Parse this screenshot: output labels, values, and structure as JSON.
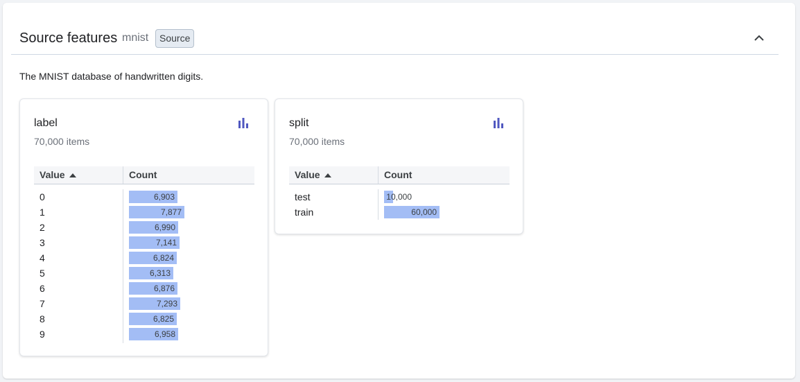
{
  "header": {
    "title": "Source features",
    "subtitle": "mnist",
    "badge": "Source",
    "collapse_icon": "chevron-up-icon"
  },
  "description": "The MNIST database of handwritten digits.",
  "accent_color": "#5058c0",
  "bar_color": "#a3bdf5",
  "cards": [
    {
      "title": "label",
      "subtitle": "70,000 items",
      "icon": "bar-chart-icon",
      "columns": [
        "Value",
        "Count"
      ],
      "sort_icon": "sort-ascending-icon",
      "rows": [
        {
          "value": "0",
          "count": 6903,
          "count_label": "6,903"
        },
        {
          "value": "1",
          "count": 7877,
          "count_label": "7,877"
        },
        {
          "value": "2",
          "count": 6990,
          "count_label": "6,990"
        },
        {
          "value": "3",
          "count": 7141,
          "count_label": "7,141"
        },
        {
          "value": "4",
          "count": 6824,
          "count_label": "6,824"
        },
        {
          "value": "5",
          "count": 6313,
          "count_label": "6,313"
        },
        {
          "value": "6",
          "count": 6876,
          "count_label": "6,876"
        },
        {
          "value": "7",
          "count": 7293,
          "count_label": "7,293"
        },
        {
          "value": "8",
          "count": 6825,
          "count_label": "6,825"
        },
        {
          "value": "9",
          "count": 6958,
          "count_label": "6,958"
        }
      ]
    },
    {
      "title": "split",
      "subtitle": "70,000 items",
      "icon": "bar-chart-icon",
      "columns": [
        "Value",
        "Count"
      ],
      "sort_icon": "sort-ascending-icon",
      "rows": [
        {
          "value": "test",
          "count": 10000,
          "count_label": "10,000"
        },
        {
          "value": "train",
          "count": 60000,
          "count_label": "60,000"
        }
      ]
    }
  ]
}
